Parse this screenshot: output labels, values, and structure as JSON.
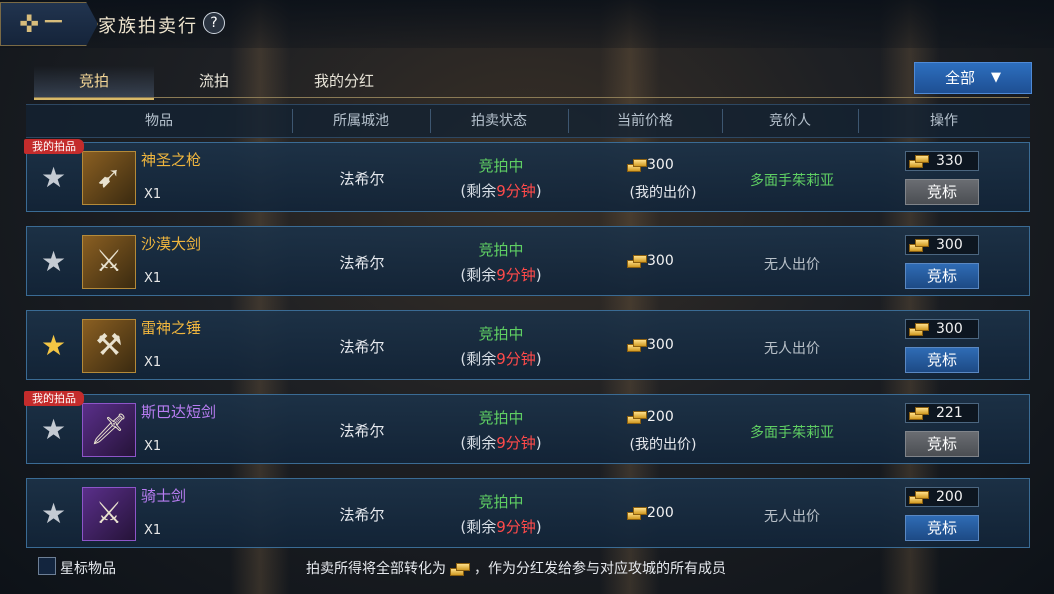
{
  "header": {
    "title": "家族拍卖行",
    "help": "?"
  },
  "tabs": [
    {
      "label": "竞拍"
    },
    {
      "label": "流拍"
    },
    {
      "label": "我的分红"
    }
  ],
  "filter": {
    "label": "全部"
  },
  "columns": [
    "物品",
    "所属城池",
    "拍卖状态",
    "当前价格",
    "竞价人",
    "操作"
  ],
  "rows": [
    {
      "badge": "我的拍品",
      "name": "神圣之枪",
      "qty": "X1",
      "city": "法希尔",
      "status": "竞拍中",
      "remain_pre": "(剩余",
      "remain_time": "9分钟",
      "remain_post": ")",
      "price": "300",
      "price_note": "(我的出价)",
      "bidder": "多面手茱莉亚",
      "bid": "330",
      "button": "竞标",
      "starred": false
    },
    {
      "badge": "",
      "name": "沙漠大剑",
      "qty": "X1",
      "city": "法希尔",
      "status": "竞拍中",
      "remain_pre": "(剩余",
      "remain_time": "9分钟",
      "remain_post": ")",
      "price": "300",
      "price_note": "",
      "bidder": "无人出价",
      "bid": "300",
      "button": "竞标",
      "starred": false
    },
    {
      "badge": "",
      "name": "雷神之锤",
      "qty": "X1",
      "city": "法希尔",
      "status": "竞拍中",
      "remain_pre": "(剩余",
      "remain_time": "9分钟",
      "remain_post": ")",
      "price": "300",
      "price_note": "",
      "bidder": "无人出价",
      "bid": "300",
      "button": "竞标",
      "starred": true
    },
    {
      "badge": "我的拍品",
      "name": "斯巴达短剑",
      "qty": "X1",
      "city": "法希尔",
      "status": "竞拍中",
      "remain_pre": "(剩余",
      "remain_time": "9分钟",
      "remain_post": ")",
      "price": "200",
      "price_note": "(我的出价)",
      "bidder": "多面手茱莉亚",
      "bid": "221",
      "button": "竞标",
      "starred": false
    },
    {
      "badge": "",
      "name": "骑士剑",
      "qty": "X1",
      "city": "法希尔",
      "status": "竞拍中",
      "remain_pre": "(剩余",
      "remain_time": "9分钟",
      "remain_post": ")",
      "price": "200",
      "price_note": "",
      "bidder": "无人出价",
      "bid": "200",
      "button": "竞标",
      "starred": false
    }
  ],
  "footer": {
    "star_label": "星标物品",
    "note_pre": "拍卖所得将全部转化为",
    "note_post": "，作为分红发给参与对应攻城的所有成员"
  },
  "colors": {
    "gold_text": "#f0b63e",
    "purple_text": "#b87df2",
    "green_text": "#5fcf63",
    "red_text": "#ff4a4a",
    "button_blue": "#2f6cb5"
  }
}
